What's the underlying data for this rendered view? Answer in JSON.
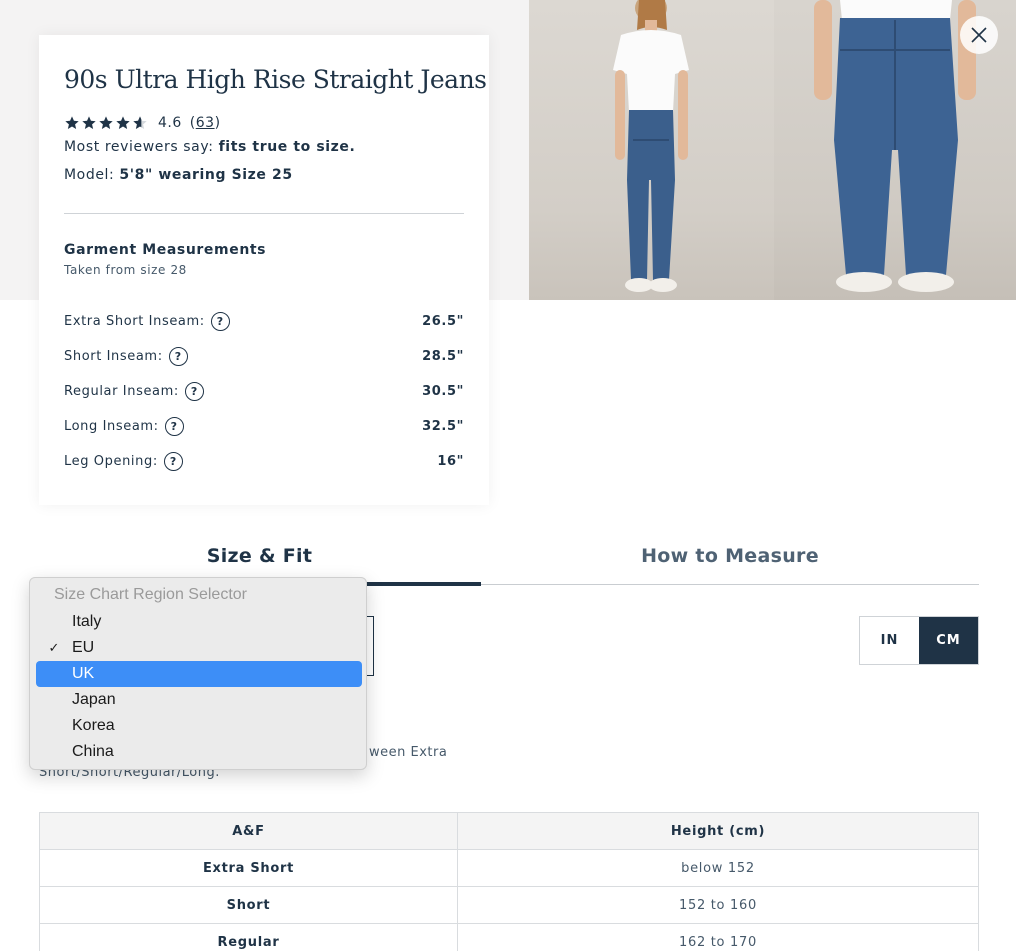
{
  "product": {
    "title": "90s Ultra High Rise Straight Jeans",
    "rating": "4.6",
    "rating_value": 4.6,
    "review_count_prefix": "(",
    "review_count": "63",
    "review_count_suffix": ")",
    "reviewers_prefix": "Most reviewers say: ",
    "reviewers_value": "fits true to size.",
    "model_prefix": "Model: ",
    "model_value": "5'8\" wearing Size 25"
  },
  "garment": {
    "title": "Garment Measurements",
    "subtitle": "Taken from size 28",
    "rows": [
      {
        "label": "Extra Short Inseam:",
        "value": "26.5\""
      },
      {
        "label": "Short Inseam:",
        "value": "28.5\""
      },
      {
        "label": "Regular Inseam:",
        "value": "30.5\""
      },
      {
        "label": "Long Inseam:",
        "value": "32.5\""
      },
      {
        "label": "Leg Opening:",
        "value": "16\""
      }
    ]
  },
  "tabs": {
    "size_fit": "Size & Fit",
    "how_to_measure": "How to Measure"
  },
  "units": {
    "in": "IN",
    "cm": "CM",
    "active": "CM"
  },
  "dropdown": {
    "header": "Size Chart Region Selector",
    "options": [
      {
        "label": "Italy",
        "checked": false,
        "highlighted": false
      },
      {
        "label": "EU",
        "checked": true,
        "highlighted": false
      },
      {
        "label": "UK",
        "checked": false,
        "highlighted": true
      },
      {
        "label": "Japan",
        "checked": false,
        "highlighted": false
      },
      {
        "label": "Korea",
        "checked": false,
        "highlighted": false
      },
      {
        "label": "China",
        "checked": false,
        "highlighted": false
      }
    ],
    "checkmark": "✓"
  },
  "note": {
    "visible_fragment_1": "ween Extra",
    "visible_fragment_2": "Short/Short/Regular/Long."
  },
  "size_table": {
    "headers": [
      "A&F",
      "Height (cm)"
    ],
    "rows": [
      [
        "Extra Short",
        "below 152"
      ],
      [
        "Short",
        "152 to 160"
      ],
      [
        "Regular",
        "162 to 170"
      ]
    ]
  },
  "colors": {
    "text_navy": "#1f3346",
    "highlight_blue": "#3d8ef7",
    "band_gray": "#f4f3f3"
  }
}
